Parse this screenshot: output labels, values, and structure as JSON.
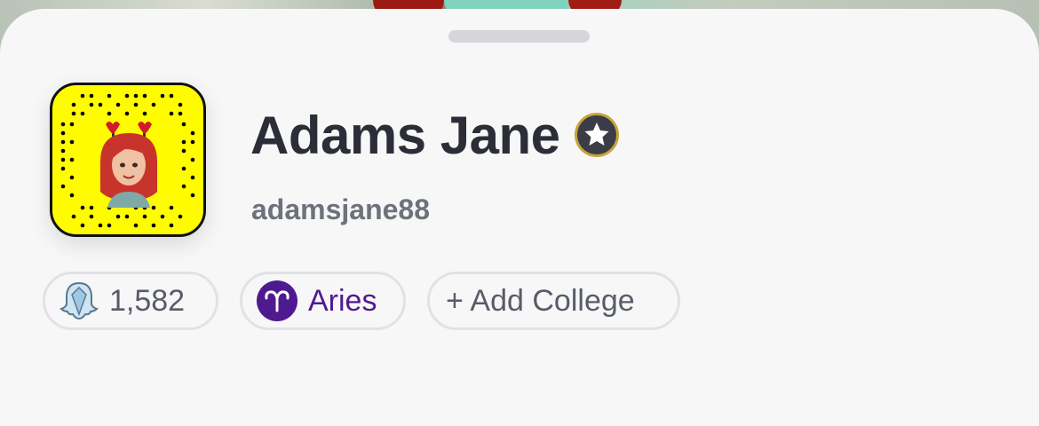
{
  "profile": {
    "display_name": "Adams Jane",
    "username": "adamsjane88",
    "badge_icon": "star-badge-icon"
  },
  "chips": {
    "snapscore": "1,582",
    "snapscore_icon": "ghost-diamond-icon",
    "zodiac": "Aries",
    "zodiac_icon": "aries-icon",
    "add_college": "+ Add College"
  },
  "colors": {
    "snapcode_yellow": "#fffc00",
    "zodiac_purple": "#4f1a8f",
    "text_dark": "#2b2e36",
    "text_gray": "#6d727b"
  }
}
